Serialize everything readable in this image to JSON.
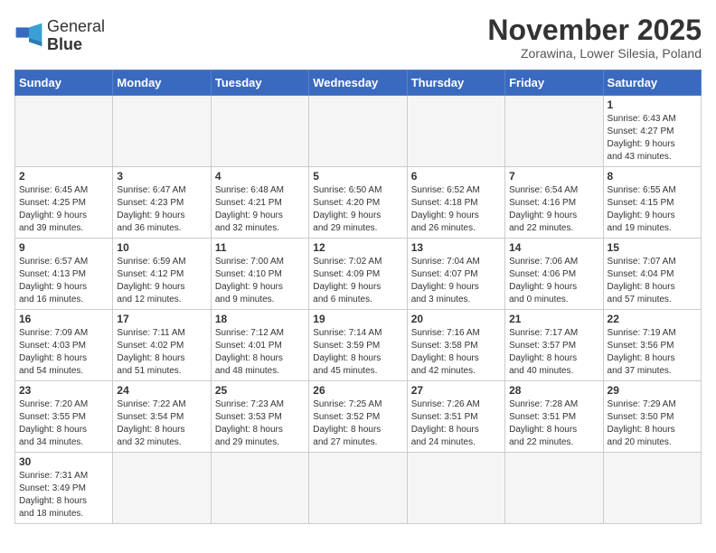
{
  "logo": {
    "text_regular": "General",
    "text_bold": "Blue"
  },
  "title": "November 2025",
  "subtitle": "Zorawina, Lower Silesia, Poland",
  "weekdays": [
    "Sunday",
    "Monday",
    "Tuesday",
    "Wednesday",
    "Thursday",
    "Friday",
    "Saturday"
  ],
  "days": [
    {
      "date": "",
      "info": ""
    },
    {
      "date": "",
      "info": ""
    },
    {
      "date": "",
      "info": ""
    },
    {
      "date": "",
      "info": ""
    },
    {
      "date": "",
      "info": ""
    },
    {
      "date": "",
      "info": ""
    },
    {
      "date": "1",
      "info": "Sunrise: 6:43 AM\nSunset: 4:27 PM\nDaylight: 9 hours\nand 43 minutes."
    },
    {
      "date": "2",
      "info": "Sunrise: 6:45 AM\nSunset: 4:25 PM\nDaylight: 9 hours\nand 39 minutes."
    },
    {
      "date": "3",
      "info": "Sunrise: 6:47 AM\nSunset: 4:23 PM\nDaylight: 9 hours\nand 36 minutes."
    },
    {
      "date": "4",
      "info": "Sunrise: 6:48 AM\nSunset: 4:21 PM\nDaylight: 9 hours\nand 32 minutes."
    },
    {
      "date": "5",
      "info": "Sunrise: 6:50 AM\nSunset: 4:20 PM\nDaylight: 9 hours\nand 29 minutes."
    },
    {
      "date": "6",
      "info": "Sunrise: 6:52 AM\nSunset: 4:18 PM\nDaylight: 9 hours\nand 26 minutes."
    },
    {
      "date": "7",
      "info": "Sunrise: 6:54 AM\nSunset: 4:16 PM\nDaylight: 9 hours\nand 22 minutes."
    },
    {
      "date": "8",
      "info": "Sunrise: 6:55 AM\nSunset: 4:15 PM\nDaylight: 9 hours\nand 19 minutes."
    },
    {
      "date": "9",
      "info": "Sunrise: 6:57 AM\nSunset: 4:13 PM\nDaylight: 9 hours\nand 16 minutes."
    },
    {
      "date": "10",
      "info": "Sunrise: 6:59 AM\nSunset: 4:12 PM\nDaylight: 9 hours\nand 12 minutes."
    },
    {
      "date": "11",
      "info": "Sunrise: 7:00 AM\nSunset: 4:10 PM\nDaylight: 9 hours\nand 9 minutes."
    },
    {
      "date": "12",
      "info": "Sunrise: 7:02 AM\nSunset: 4:09 PM\nDaylight: 9 hours\nand 6 minutes."
    },
    {
      "date": "13",
      "info": "Sunrise: 7:04 AM\nSunset: 4:07 PM\nDaylight: 9 hours\nand 3 minutes."
    },
    {
      "date": "14",
      "info": "Sunrise: 7:06 AM\nSunset: 4:06 PM\nDaylight: 9 hours\nand 0 minutes."
    },
    {
      "date": "15",
      "info": "Sunrise: 7:07 AM\nSunset: 4:04 PM\nDaylight: 8 hours\nand 57 minutes."
    },
    {
      "date": "16",
      "info": "Sunrise: 7:09 AM\nSunset: 4:03 PM\nDaylight: 8 hours\nand 54 minutes."
    },
    {
      "date": "17",
      "info": "Sunrise: 7:11 AM\nSunset: 4:02 PM\nDaylight: 8 hours\nand 51 minutes."
    },
    {
      "date": "18",
      "info": "Sunrise: 7:12 AM\nSunset: 4:01 PM\nDaylight: 8 hours\nand 48 minutes."
    },
    {
      "date": "19",
      "info": "Sunrise: 7:14 AM\nSunset: 3:59 PM\nDaylight: 8 hours\nand 45 minutes."
    },
    {
      "date": "20",
      "info": "Sunrise: 7:16 AM\nSunset: 3:58 PM\nDaylight: 8 hours\nand 42 minutes."
    },
    {
      "date": "21",
      "info": "Sunrise: 7:17 AM\nSunset: 3:57 PM\nDaylight: 8 hours\nand 40 minutes."
    },
    {
      "date": "22",
      "info": "Sunrise: 7:19 AM\nSunset: 3:56 PM\nDaylight: 8 hours\nand 37 minutes."
    },
    {
      "date": "23",
      "info": "Sunrise: 7:20 AM\nSunset: 3:55 PM\nDaylight: 8 hours\nand 34 minutes."
    },
    {
      "date": "24",
      "info": "Sunrise: 7:22 AM\nSunset: 3:54 PM\nDaylight: 8 hours\nand 32 minutes."
    },
    {
      "date": "25",
      "info": "Sunrise: 7:23 AM\nSunset: 3:53 PM\nDaylight: 8 hours\nand 29 minutes."
    },
    {
      "date": "26",
      "info": "Sunrise: 7:25 AM\nSunset: 3:52 PM\nDaylight: 8 hours\nand 27 minutes."
    },
    {
      "date": "27",
      "info": "Sunrise: 7:26 AM\nSunset: 3:51 PM\nDaylight: 8 hours\nand 24 minutes."
    },
    {
      "date": "28",
      "info": "Sunrise: 7:28 AM\nSunset: 3:51 PM\nDaylight: 8 hours\nand 22 minutes."
    },
    {
      "date": "29",
      "info": "Sunrise: 7:29 AM\nSunset: 3:50 PM\nDaylight: 8 hours\nand 20 minutes."
    },
    {
      "date": "30",
      "info": "Sunrise: 7:31 AM\nSunset: 3:49 PM\nDaylight: 8 hours\nand 18 minutes."
    },
    {
      "date": "",
      "info": ""
    },
    {
      "date": "",
      "info": ""
    },
    {
      "date": "",
      "info": ""
    },
    {
      "date": "",
      "info": ""
    },
    {
      "date": "",
      "info": ""
    },
    {
      "date": "",
      "info": ""
    }
  ]
}
